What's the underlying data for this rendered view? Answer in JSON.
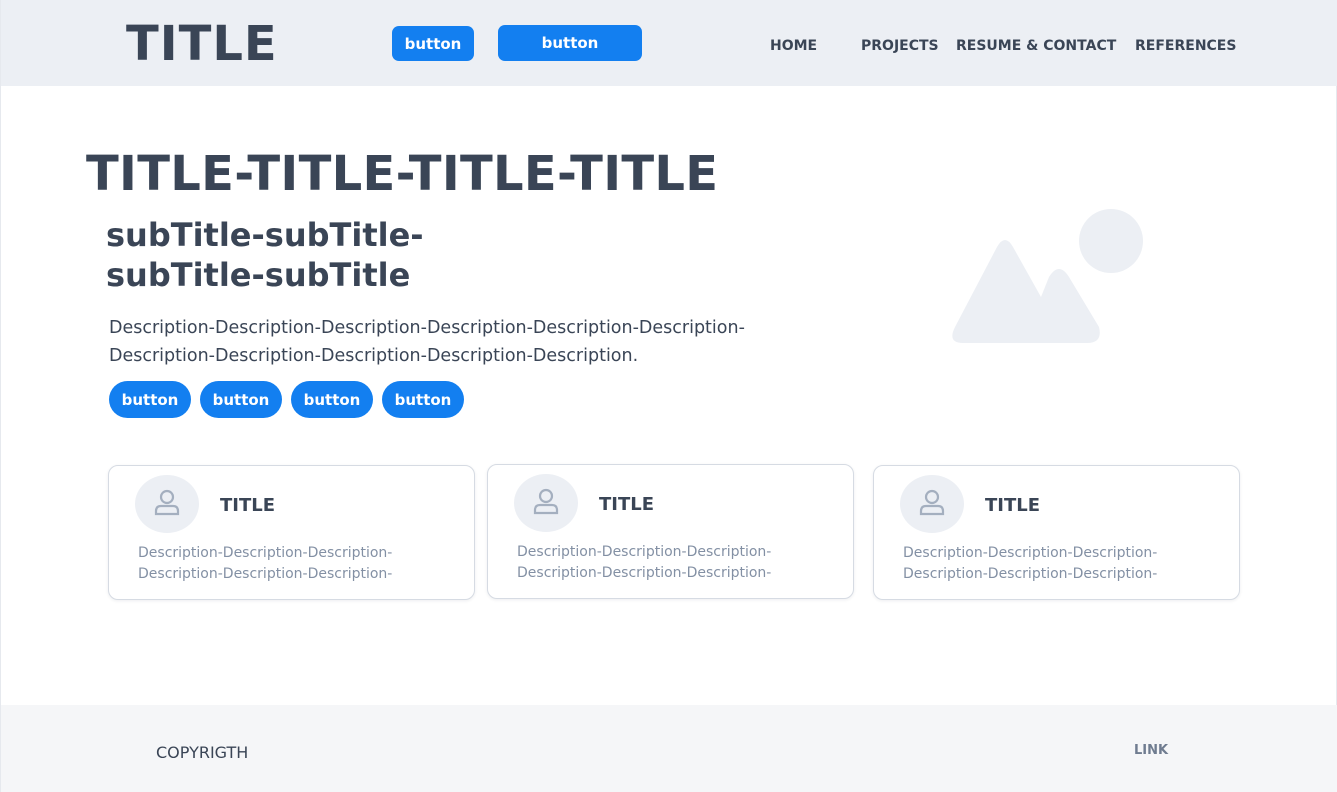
{
  "header": {
    "logo": "TITLE",
    "buttons": [
      "button",
      "button"
    ],
    "nav": [
      "HOME",
      "PROJECTS",
      "RESUME & CONTACT",
      "REFERENCES"
    ]
  },
  "hero": {
    "title": "TITLE-TITLE-TITLE-TITLE",
    "subtitle": "subTitle-subTitle-subTitle-subTitle",
    "description": "Description-Description-Description-Description-Description-Description-Description-Description-Description-Description-Description.",
    "buttons": [
      "button",
      "button",
      "button",
      "button"
    ],
    "image_icon": "image-placeholder-icon"
  },
  "cards": [
    {
      "title": "TITLE",
      "description": "Description-Description-Description-Description-Description-Description-",
      "icon": "user-icon"
    },
    {
      "title": "TITLE",
      "description": "Description-Description-Description-Description-Description-Description-",
      "icon": "user-icon"
    },
    {
      "title": "TITLE",
      "description": "Description-Description-Description-Description-Description-Description-",
      "icon": "user-icon"
    }
  ],
  "footer": {
    "copyright": "COPYRIGTH",
    "link": "LINK"
  },
  "colors": {
    "accent": "#137ff0",
    "header_bg": "#eceff4",
    "text": "#3a4556",
    "muted": "#8390a4",
    "footer_bg": "#f5f6f8"
  }
}
